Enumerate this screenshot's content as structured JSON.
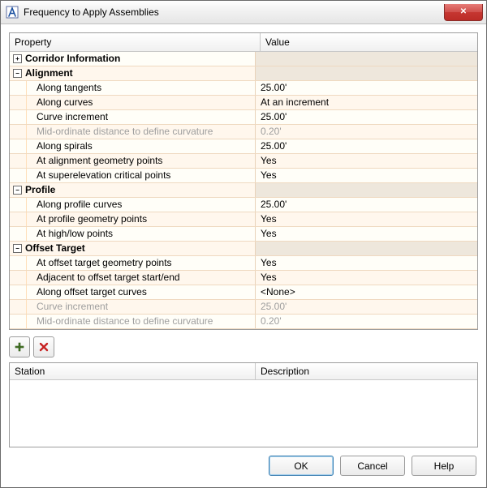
{
  "window": {
    "title": "Frequency to Apply Assemblies"
  },
  "grid": {
    "headers": {
      "property": "Property",
      "value": "Value"
    },
    "groups": {
      "corridor": {
        "label": "Corridor Information",
        "expanded": false
      },
      "alignment": {
        "label": "Alignment",
        "expanded": true,
        "rows": [
          {
            "label": "Along tangents",
            "value": "25.00'"
          },
          {
            "label": "Along curves",
            "value": "At an increment"
          },
          {
            "label": "Curve increment",
            "value": "25.00'"
          },
          {
            "label": "Mid-ordinate distance to define curvature",
            "value": "0.20'",
            "disabled": true
          },
          {
            "label": "Along spirals",
            "value": "25.00'"
          },
          {
            "label": "At alignment geometry points",
            "value": "Yes"
          },
          {
            "label": "At superelevation critical points",
            "value": "Yes"
          }
        ]
      },
      "profile": {
        "label": "Profile",
        "expanded": true,
        "rows": [
          {
            "label": "Along profile curves",
            "value": "25.00'"
          },
          {
            "label": "At profile geometry points",
            "value": "Yes"
          },
          {
            "label": "At high/low points",
            "value": "Yes"
          }
        ]
      },
      "offset": {
        "label": "Offset Target",
        "expanded": true,
        "rows": [
          {
            "label": "At offset target geometry points",
            "value": "Yes"
          },
          {
            "label": "Adjacent to offset target start/end",
            "value": "Yes"
          },
          {
            "label": "Along offset target curves",
            "value": "<None>"
          },
          {
            "label": "Curve increment",
            "value": "25.00'",
            "disabled": true
          },
          {
            "label": "Mid-ordinate distance to define curvature",
            "value": "0.20'",
            "disabled": true
          }
        ]
      }
    }
  },
  "list": {
    "headers": {
      "station": "Station",
      "description": "Description"
    }
  },
  "buttons": {
    "ok": "OK",
    "cancel": "Cancel",
    "help": "Help"
  },
  "icons": {
    "plus": "+",
    "minus": "−",
    "expand": "+",
    "collapse": "−",
    "x": "✕"
  }
}
